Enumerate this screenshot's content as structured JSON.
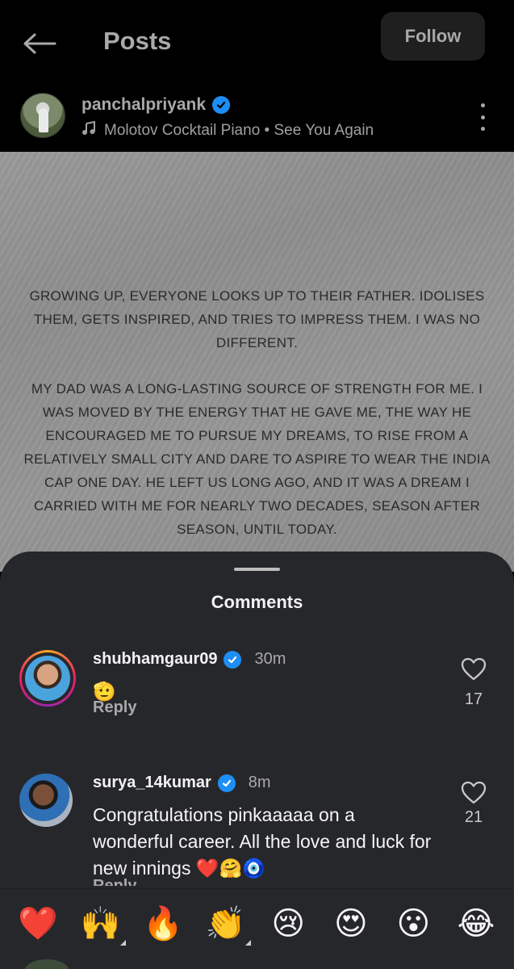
{
  "header": {
    "title": "Posts",
    "follow_label": "Follow"
  },
  "post": {
    "username": "panchalpriyank",
    "verified": true,
    "music": "Molotov Cocktail Piano",
    "music_separator": " • ",
    "song": "See You Again",
    "text_para1": "GROWING UP, EVERYONE LOOKS UP TO THEIR FATHER. IDOLISES THEM, GETS INSPIRED, AND TRIES TO IMPRESS THEM. I WAS NO DIFFERENT.",
    "text_para2": "MY DAD WAS A LONG-LASTING SOURCE OF STRENGTH FOR ME. I WAS MOVED BY THE ENERGY THAT HE GAVE ME, THE WAY HE ENCOURAGED ME TO PURSUE MY DREAMS, TO RISE FROM A RELATIVELY SMALL CITY AND DARE TO ASPIRE TO WEAR THE INDIA CAP ONE DAY. HE LEFT US LONG AGO, AND IT WAS A DREAM I CARRIED WITH ME FOR NEARLY TWO DECADES, SEASON AFTER SEASON, UNTIL TODAY."
  },
  "comments_sheet": {
    "title": "Comments",
    "comments": [
      {
        "username": "shubhamgaur09",
        "verified": true,
        "time": "30m",
        "text": "🫡",
        "reply_label": "Reply",
        "likes": "17"
      },
      {
        "username": "surya_14kumar",
        "verified": true,
        "time": "8m",
        "text": "Congratulations pinkaaaaa on a wonderful career. All the love and luck for new innings ❤️🤗🧿",
        "reply_label": "Reply",
        "likes": "21"
      }
    ]
  },
  "reactions": [
    "❤️",
    "🙌",
    "🔥",
    "👏",
    "😢",
    "😍",
    "😮",
    "😂"
  ],
  "colors": {
    "verified": "#1d8ef5",
    "sheet_bg": "#26272b",
    "post_bg": "#959595"
  }
}
